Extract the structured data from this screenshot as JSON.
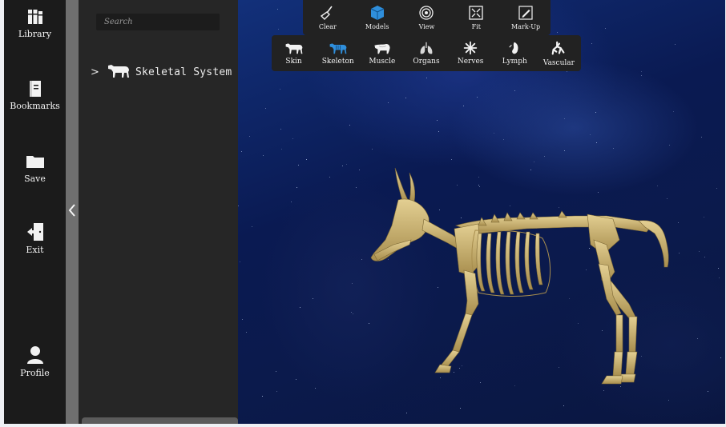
{
  "sidebar": {
    "items": [
      {
        "label": "Library",
        "icon": "library-icon"
      },
      {
        "label": "Bookmarks",
        "icon": "bookmark-icon"
      },
      {
        "label": "Save",
        "icon": "folder-icon"
      },
      {
        "label": "Exit",
        "icon": "exit-icon"
      },
      {
        "label": "Profile",
        "icon": "user-icon"
      }
    ]
  },
  "panel": {
    "search_placeholder": "Search",
    "tree": [
      {
        "label": "Skeletal System",
        "icon": "cow-icon",
        "expanded": false
      }
    ]
  },
  "toolbar_top": {
    "items": [
      {
        "label": "Clear",
        "icon": "broom-icon"
      },
      {
        "label": "Models",
        "icon": "cube-icon",
        "active": true
      },
      {
        "label": "View",
        "icon": "target-icon"
      },
      {
        "label": "Fit",
        "icon": "expand-icon"
      },
      {
        "label": "Mark-Up",
        "icon": "pen-icon"
      }
    ]
  },
  "toolbar_layers": {
    "items": [
      {
        "label": "Skin",
        "icon": "cow-skin-icon"
      },
      {
        "label": "Skeleton",
        "icon": "cow-skeleton-icon",
        "active": true
      },
      {
        "label": "Muscle",
        "icon": "muscle-icon"
      },
      {
        "label": "Organs",
        "icon": "lungs-icon"
      },
      {
        "label": "Nerves",
        "icon": "nerves-icon"
      },
      {
        "label": "Lymph",
        "icon": "lymph-icon"
      },
      {
        "label": "Vascular",
        "icon": "vascular-icon"
      }
    ]
  },
  "colors": {
    "accent": "#2f8fdc",
    "bone": "#cdb77a",
    "rail": "#1b1b1b",
    "panel": "#262626"
  }
}
